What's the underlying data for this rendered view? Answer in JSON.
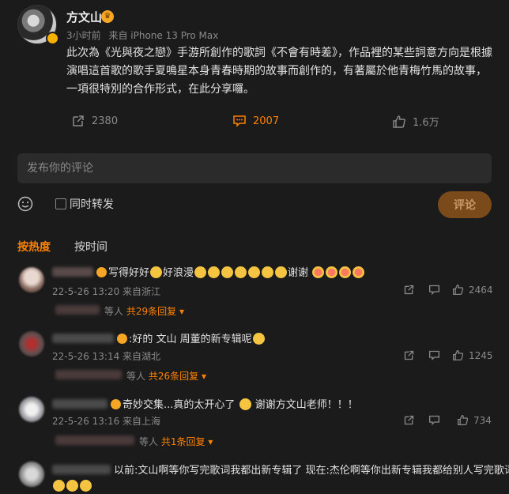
{
  "post": {
    "author": "方文山",
    "time": "3小时前",
    "source": "来自 iPhone 13 Pro Max",
    "text": "此次為《光與夜之戀》手游所創作的歌詞《不會有時差》，作品裡的某些詞意方向是根據演唱這首歌的歌手夏鳴星本身青春時期的故事而創作的，有著屬於他青梅竹馬的故事，一項很特別的合作形式，在此分享囉。",
    "reposts": "2380",
    "comments": "2007",
    "likes": "1.6万"
  },
  "composer": {
    "placeholder": "发布你的评论",
    "repost_label": "同时转发",
    "submit_label": "评论"
  },
  "sort_tabs": {
    "hot": "按热度",
    "time": "按时间"
  },
  "comments": [
    {
      "text_a": "写得好好",
      "text_b": "好浪漫",
      "text_c": "谢谢",
      "meta": "22-5-26 13:20 来自浙江",
      "likes": "2464",
      "reply_prefix": "等人",
      "reply_count": "共29条回复"
    },
    {
      "text_a": ":好的 文山 周董的新专辑呢",
      "meta": "22-5-26 13:14 来自湖北",
      "likes": "1245",
      "reply_prefix": "等人",
      "reply_count": "共26条回复"
    },
    {
      "text_a": "奇妙交集...真的太开心了",
      "text_b": "谢谢方文山老师！！！",
      "meta": "22-5-26 13:16 来自上海",
      "likes": "734",
      "reply_prefix": "等人",
      "reply_count": "共1条回复"
    },
    {
      "text_a": "以前:文山啊等你写完歌词我都出新专辑了 现在:杰伦啊等你出新专辑我都给别人写完歌词了"
    }
  ],
  "colors": {
    "accent": "#ff8200",
    "background": "#1b1b1c"
  }
}
